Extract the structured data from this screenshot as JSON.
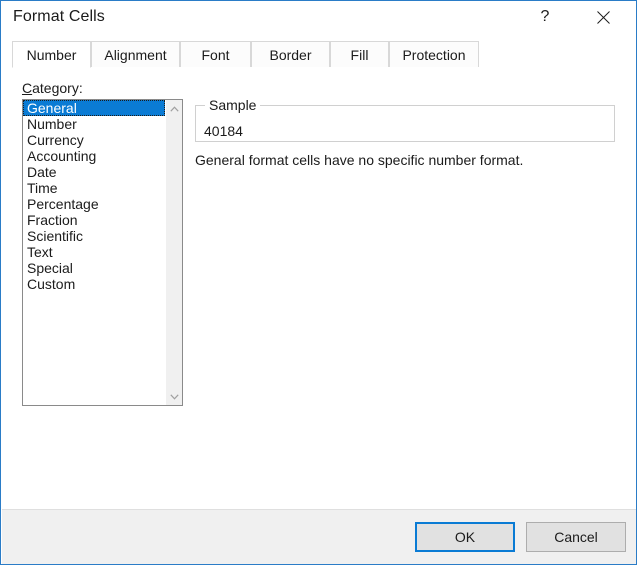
{
  "window": {
    "title": "Format Cells",
    "help_icon": "question-mark-icon",
    "close_icon": "close-icon",
    "accent_color": "#0a7bd4",
    "border_color": "#2a7cc7"
  },
  "tabs": [
    {
      "label": "Number",
      "active": true
    },
    {
      "label": "Alignment",
      "active": false
    },
    {
      "label": "Font",
      "active": false
    },
    {
      "label": "Border",
      "active": false
    },
    {
      "label": "Fill",
      "active": false
    },
    {
      "label": "Protection",
      "active": false
    }
  ],
  "category": {
    "label_accel": "C",
    "label_rest": "ategory:",
    "items": [
      {
        "label": "General",
        "selected": true
      },
      {
        "label": "Number",
        "selected": false
      },
      {
        "label": "Currency",
        "selected": false
      },
      {
        "label": "Accounting",
        "selected": false
      },
      {
        "label": "Date",
        "selected": false
      },
      {
        "label": "Time",
        "selected": false
      },
      {
        "label": "Percentage",
        "selected": false
      },
      {
        "label": "Fraction",
        "selected": false
      },
      {
        "label": "Scientific",
        "selected": false
      },
      {
        "label": "Text",
        "selected": false
      },
      {
        "label": "Special",
        "selected": false
      },
      {
        "label": "Custom",
        "selected": false
      }
    ],
    "scrollbar": {
      "up_icon": "chevron-up-icon",
      "down_icon": "chevron-down-icon"
    }
  },
  "sample": {
    "legend": "Sample",
    "value": "40184"
  },
  "description": "General format cells have no specific number format.",
  "footer": {
    "ok_label": "OK",
    "cancel_label": "Cancel"
  }
}
